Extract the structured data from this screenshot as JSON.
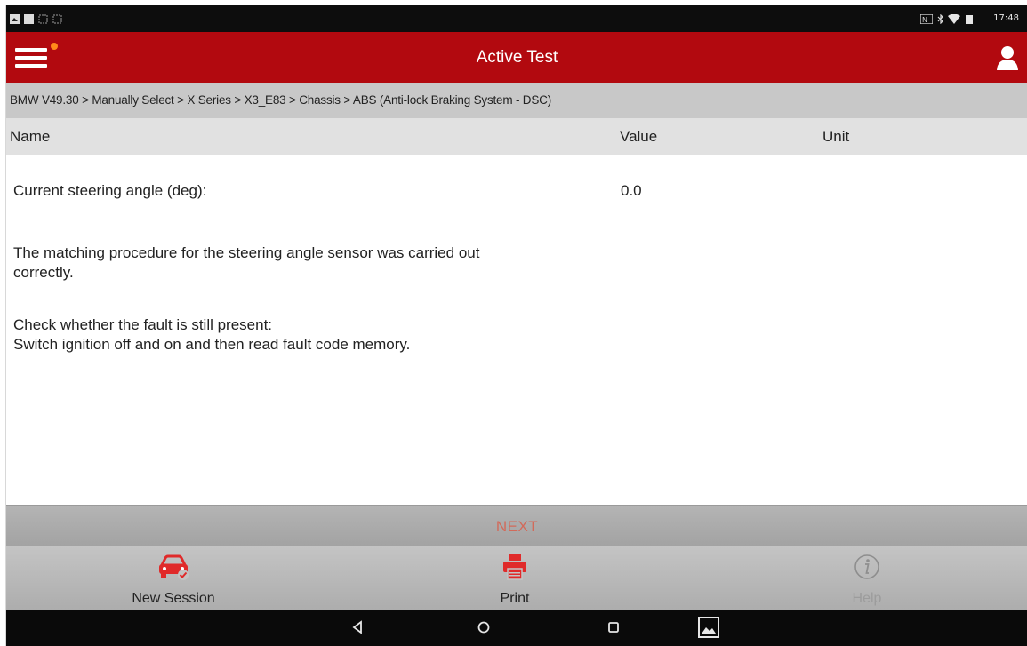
{
  "status_bar": {
    "time": "17:48"
  },
  "header": {
    "title": "Active Test"
  },
  "breadcrumb": "BMW V49.30 > Manually Select > X Series > X3_E83 > Chassis > ABS (Anti-lock Braking System - DSC)",
  "table": {
    "columns": {
      "name": "Name",
      "value": "Value",
      "unit": "Unit"
    },
    "rows": [
      {
        "name": "Current steering angle (deg):",
        "value": "0.0",
        "unit": ""
      },
      {
        "name": "The matching procedure for the steering angle sensor was carried out\ncorrectly.",
        "value": "",
        "unit": ""
      },
      {
        "name": "Check whether the fault is still present:\nSwitch ignition off and on and then read fault code memory.",
        "value": "",
        "unit": ""
      }
    ]
  },
  "next_label": "NEXT",
  "toolbar": {
    "new_session_label": "New Session",
    "print_label": "Print",
    "help_label": "Help"
  },
  "colors": {
    "title_bar": "#b2090f",
    "accent_icon": "#e02a2a",
    "next_text": "#d26a5a",
    "menu_badge": "#ff8a1a"
  },
  "icons": {
    "menu": "hamburger-icon",
    "user": "user-icon",
    "new_session": "car-check-icon",
    "print": "printer-icon",
    "help": "info-circle-icon",
    "nav_back": "back-triangle-icon",
    "nav_home": "home-circle-icon",
    "nav_recents": "recents-square-icon",
    "nav_screenshot": "gallery-icon"
  }
}
